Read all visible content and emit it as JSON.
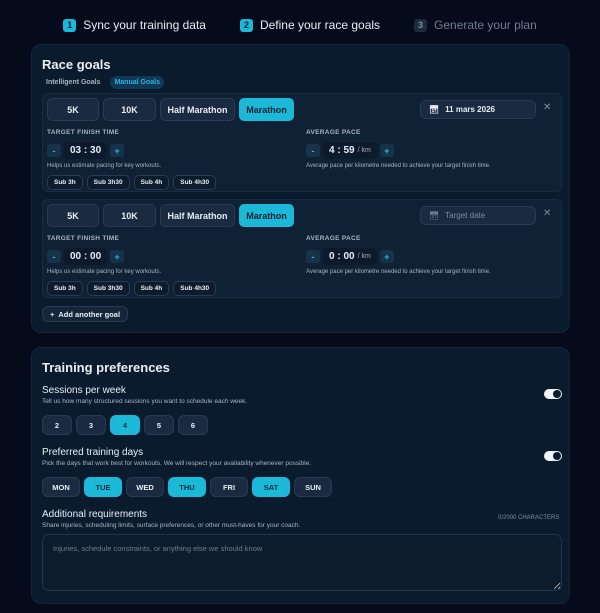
{
  "steps": [
    {
      "n": "1",
      "label": "Sync your training data"
    },
    {
      "n": "2",
      "label": "Define your race goals"
    },
    {
      "n": "3",
      "label": "Generate your plan"
    }
  ],
  "race_goals": {
    "title": "Race goals",
    "modes": [
      "Intelligent Goals",
      "Manual Goals"
    ],
    "distances": [
      "5K",
      "10K",
      "Half Marathon",
      "Marathon"
    ],
    "add_label": "Add another goal",
    "goals": [
      {
        "selected": "Marathon",
        "date": "11 mars 2026",
        "finish_label": "TARGET FINISH TIME",
        "finish_h": "03",
        "finish_m": "30",
        "finish_hint": "Helps us estimate pacing for key workouts.",
        "chips": [
          "Sub 3h",
          "Sub 3h30",
          "Sub 4h",
          "Sub 4h30"
        ],
        "pace_label": "AVERAGE PACE",
        "pace_m": "4",
        "pace_s": "59",
        "pace_unit": "/ km",
        "pace_hint": "Average pace per kilometre needed to achieve your target finish time."
      },
      {
        "selected": "Marathon",
        "date_placeholder": "Target date",
        "finish_label": "TARGET FINISH TIME",
        "finish_h": "00",
        "finish_m": "00",
        "finish_hint": "Helps us estimate pacing for key workouts.",
        "chips": [
          "Sub 3h",
          "Sub 3h30",
          "Sub 4h",
          "Sub 4h30"
        ],
        "pace_label": "AVERAGE PACE",
        "pace_m": "0",
        "pace_s": "00",
        "pace_unit": "/ km",
        "pace_hint": "Average pace per kilometre needed to achieve your target finish time."
      }
    ]
  },
  "prefs": {
    "title": "Training preferences",
    "sessions": {
      "title": "Sessions per week",
      "sub": "Tell us how many structured sessions you want to schedule each week.",
      "options": [
        "2",
        "3",
        "4",
        "5",
        "6"
      ],
      "selected": "4",
      "enabled": true
    },
    "days": {
      "title": "Preferred training days",
      "sub": "Pick the days that work best for workouts. We will respect your availability whenever possible.",
      "options": [
        "MON",
        "TUE",
        "WED",
        "THU",
        "FRI",
        "SAT",
        "SUN"
      ],
      "selected": [
        "TUE",
        "THU",
        "SAT"
      ],
      "enabled": true
    },
    "additional": {
      "title": "Additional requirements",
      "sub": "Share injuries, scheduling limits, surface preferences, or other must-haves for your coach.",
      "counter": "0/2000 CHARACTERS",
      "placeholder": "Injuries, schedule constraints, or anything else we should know",
      "value": ""
    }
  },
  "colors": {
    "accent": "#1cb8d8",
    "background": "#050b1a",
    "card": "#0b1b2e"
  }
}
